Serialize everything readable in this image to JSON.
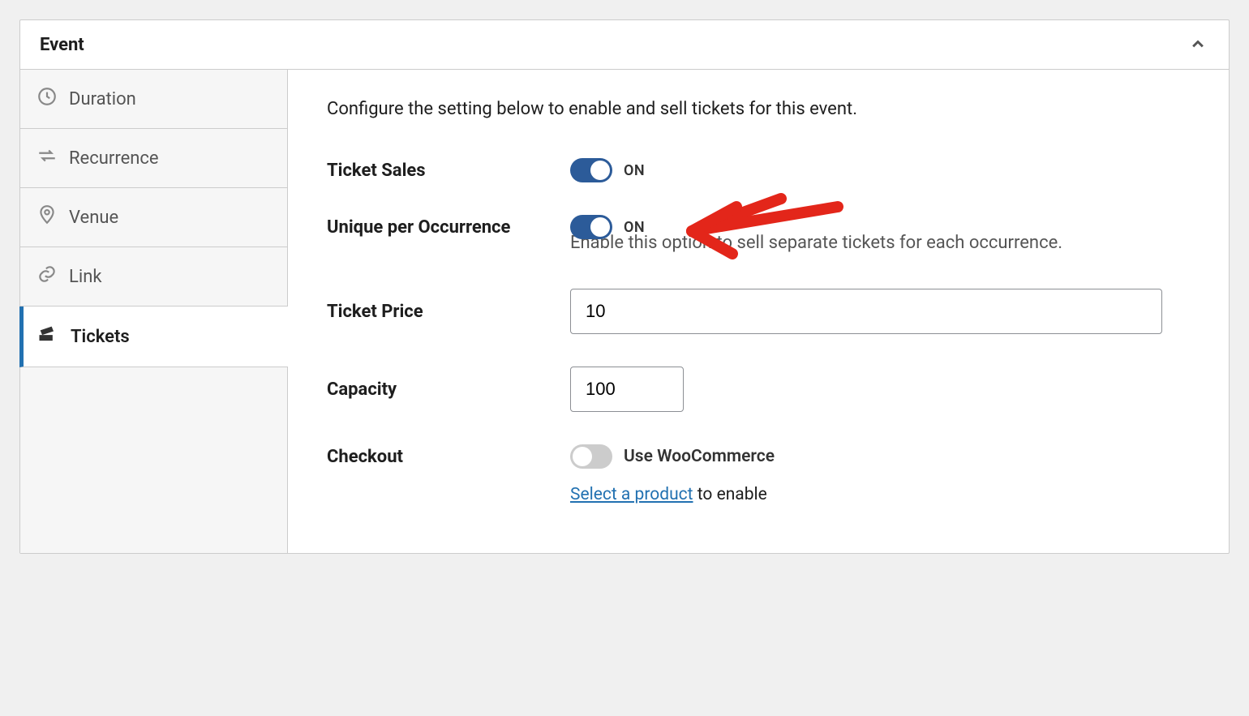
{
  "panel": {
    "title": "Event"
  },
  "sidebar": {
    "items": [
      {
        "label": "Duration",
        "icon": "clock-icon",
        "active": false
      },
      {
        "label": "Recurrence",
        "icon": "loop-icon",
        "active": false
      },
      {
        "label": "Venue",
        "icon": "pin-icon",
        "active": false
      },
      {
        "label": "Link",
        "icon": "link-icon",
        "active": false
      },
      {
        "label": "Tickets",
        "icon": "tickets-icon",
        "active": true
      }
    ]
  },
  "content": {
    "intro": "Configure the setting below to enable and sell tickets for this event.",
    "ticket_sales": {
      "label": "Ticket Sales",
      "state": "ON",
      "on": true
    },
    "unique": {
      "label": "Unique per Occurrence",
      "state": "ON",
      "on": true,
      "help": "Enable this option to sell separate tickets for each occurrence."
    },
    "price": {
      "label": "Ticket Price",
      "value": "10"
    },
    "capacity": {
      "label": "Capacity",
      "value": "100"
    },
    "checkout": {
      "label": "Checkout",
      "toggle_label": "Use WooCommerce",
      "on": false,
      "link_text": "Select a product",
      "suffix": " to enable"
    }
  }
}
